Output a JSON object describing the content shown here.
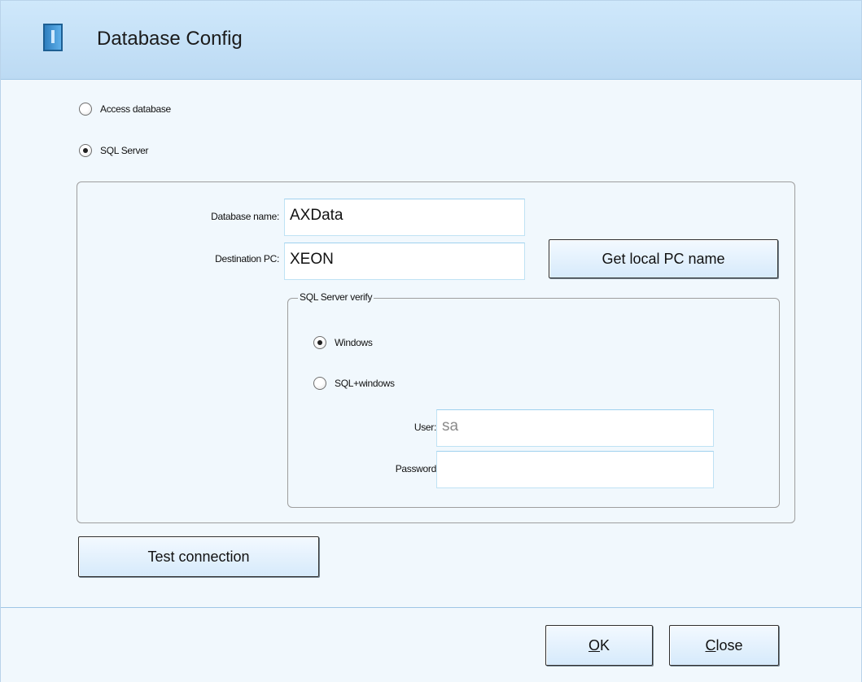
{
  "window": {
    "title": "Database Config",
    "icon": "door-icon"
  },
  "db_type": {
    "options": [
      {
        "label": "Access database",
        "checked": false
      },
      {
        "label": "SQL Server",
        "checked": true
      }
    ]
  },
  "connection": {
    "db_name_label": "Database name:",
    "db_name_value": "AXData",
    "dest_pc_label": "Destination PC:",
    "dest_pc_value": "XEON",
    "get_local_pc_button": "Get local PC name"
  },
  "verify": {
    "legend": "SQL Server verify",
    "options": [
      {
        "label": "Windows",
        "checked": true
      },
      {
        "label": "SQL+windows",
        "checked": false
      }
    ],
    "user_label": "User:",
    "user_value": "sa",
    "password_label": "Password",
    "password_value": ""
  },
  "actions": {
    "test_connection": "Test connection",
    "ok_mnemonic": "O",
    "ok_rest": "K",
    "close_mnemonic": "C",
    "close_rest": "lose"
  }
}
